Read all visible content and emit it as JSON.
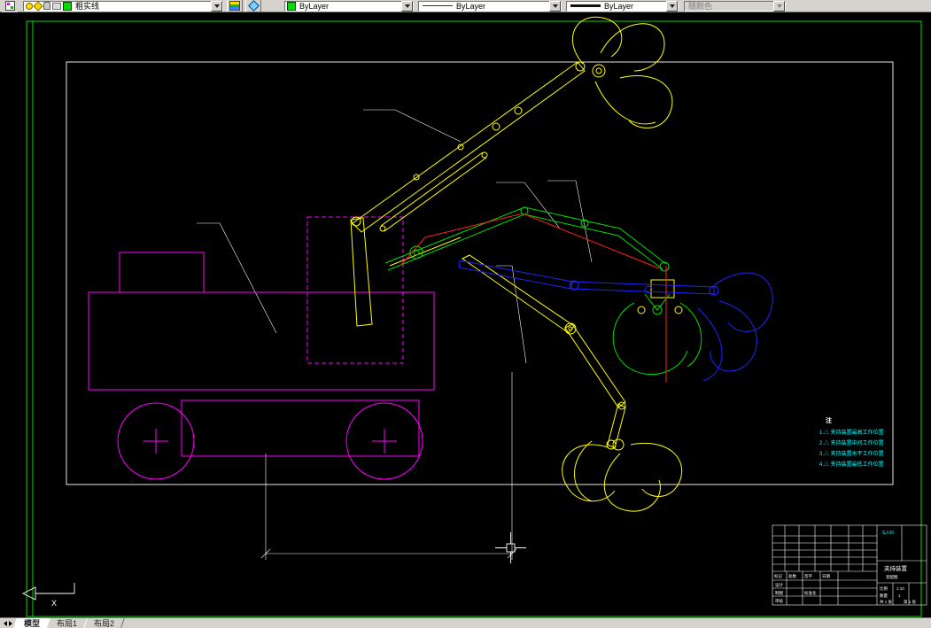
{
  "toolbar": {
    "layer_combo": {
      "value": "粗实线"
    },
    "color_combo": {
      "value": "ByLayer"
    },
    "linetype_combo": {
      "value": "ByLayer"
    },
    "lineweight_combo": {
      "value": "ByLayer"
    },
    "plotstyle_combo": {
      "value": "随颜色",
      "disabled": true
    }
  },
  "palette": {
    "magenta": "#ff00ff",
    "yellow": "#ffff00",
    "green": "#00dd00",
    "blue": "#2222ff",
    "red": "#ff2020",
    "white": "#ffffff",
    "cyan": "#00ffff"
  },
  "canvas": {
    "ucs_axis_label": "X"
  },
  "notes": {
    "title": "注",
    "items": [
      "1.△ 夹持装置最高工作位置",
      "2.△ 夹持装置中间工作位置",
      "3.△ 夹持装置水平工作位置",
      "4.△ 夹持装置最低工作位置"
    ]
  },
  "titleblock": {
    "mark": "标记",
    "count": "处数",
    "sign": "签字",
    "date": "日期",
    "design": "设计",
    "draft": "制图",
    "check": "审核",
    "std": "标准化",
    "name": "夹持装置",
    "type_label": "装配图",
    "scale_label": "比例",
    "scale": "1:10",
    "qty_label": "数量",
    "qty": "1",
    "sheet": "共 1 张",
    "page": "第 1 张",
    "code": "SJ-00"
  },
  "tabs": {
    "items": [
      "模型",
      "布局1",
      "布局2"
    ],
    "active_index": 0
  }
}
